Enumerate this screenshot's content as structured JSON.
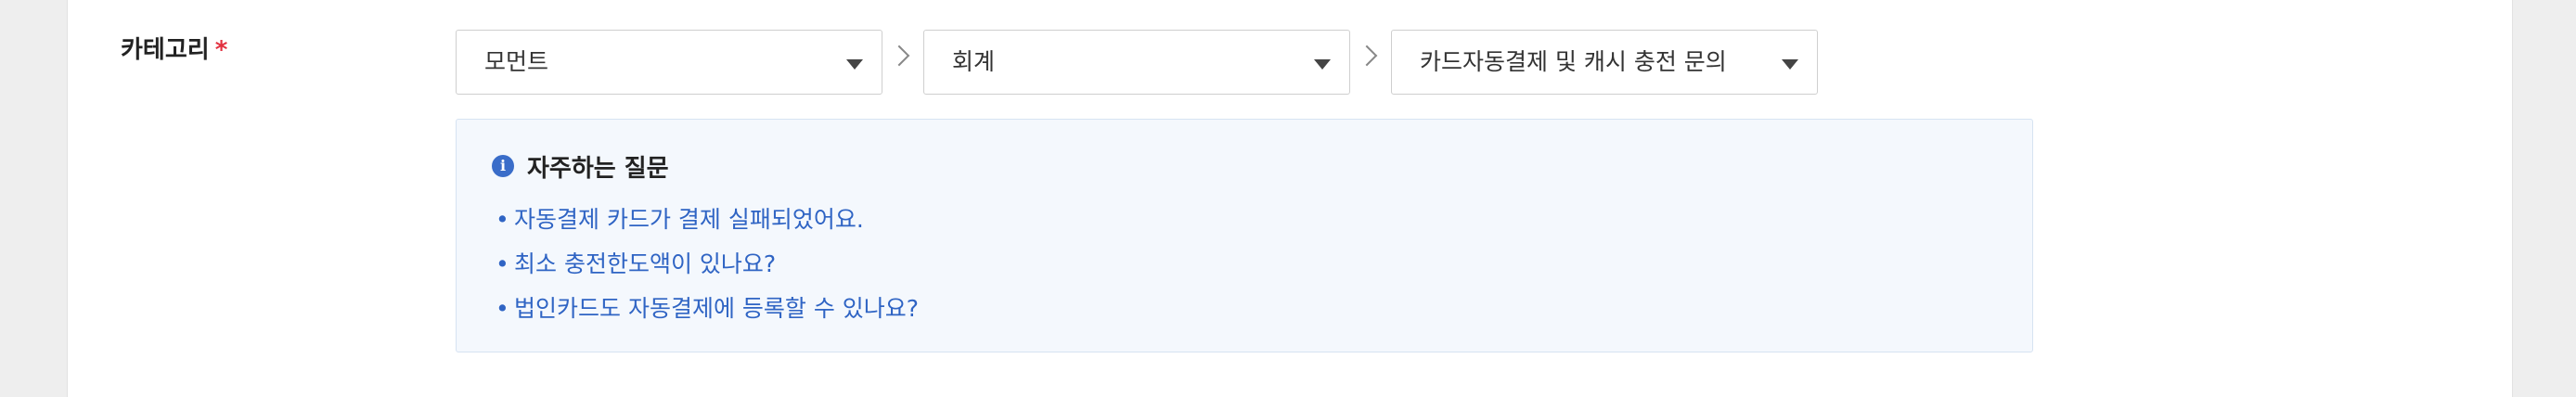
{
  "category": {
    "label": "카테고리",
    "required_mark": "*",
    "selects": [
      {
        "value": "모먼트"
      },
      {
        "value": "회계"
      },
      {
        "value": "카드자동결제 및 캐시 충전 문의"
      }
    ]
  },
  "faq": {
    "icon": "info-icon",
    "icon_glyph": "i",
    "title": "자주하는 질문",
    "bullet": "•",
    "items": [
      {
        "text": "자동결제 카드가 결제 실패되었어요."
      },
      {
        "text": "최소 충전한도액이 있나요?"
      },
      {
        "text": "법인카드도 자동결제에 등록할 수 있나요?"
      }
    ]
  },
  "colors": {
    "required": "#e2303f",
    "link": "#2f64c4",
    "faq_background": "#f4f8fd",
    "info_icon": "#3a6dc9"
  }
}
